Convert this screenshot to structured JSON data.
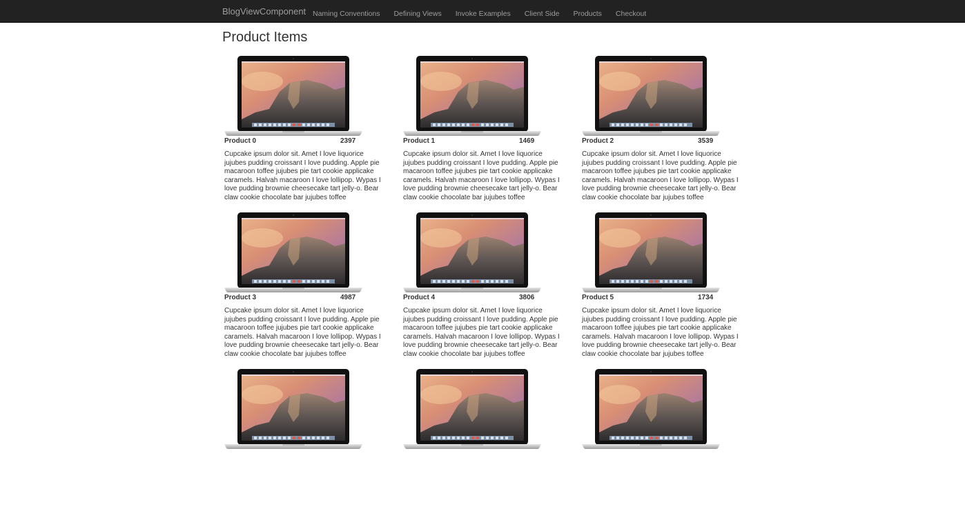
{
  "navbar": {
    "brand": "BlogViewComponent",
    "links": [
      {
        "label": "Naming Conventions"
      },
      {
        "label": "Defining Views"
      },
      {
        "label": "Invoke Examples"
      },
      {
        "label": "Client Side"
      },
      {
        "label": "Products"
      },
      {
        "label": "Checkout"
      }
    ],
    "background": "#222222",
    "link_color": "#9d9d9d"
  },
  "page": {
    "title": "Product Items"
  },
  "products": [
    {
      "name": "Product 0",
      "price": "2397",
      "image": "laptop-image",
      "description": "Cupcake ipsum dolor sit. Amet I love liquorice jujubes pudding croissant I love pudding. Apple pie macaroon toffee jujubes pie tart cookie applicake caramels. Halvah macaroon I love lollipop. Wypas I love pudding brownie cheesecake tart jelly-o. Bear claw cookie chocolate bar jujubes toffee"
    },
    {
      "name": "Product 1",
      "price": "1469",
      "image": "laptop-image",
      "description": "Cupcake ipsum dolor sit. Amet I love liquorice jujubes pudding croissant I love pudding. Apple pie macaroon toffee jujubes pie tart cookie applicake caramels. Halvah macaroon I love lollipop. Wypas I love pudding brownie cheesecake tart jelly-o. Bear claw cookie chocolate bar jujubes toffee"
    },
    {
      "name": "Product 2",
      "price": "3539",
      "image": "laptop-image",
      "description": "Cupcake ipsum dolor sit. Amet I love liquorice jujubes pudding croissant I love pudding. Apple pie macaroon toffee jujubes pie tart cookie applicake caramels. Halvah macaroon I love lollipop. Wypas I love pudding brownie cheesecake tart jelly-o. Bear claw cookie chocolate bar jujubes toffee"
    },
    {
      "name": "Product 3",
      "price": "4987",
      "image": "laptop-image",
      "description": "Cupcake ipsum dolor sit. Amet I love liquorice jujubes pudding croissant I love pudding. Apple pie macaroon toffee jujubes pie tart cookie applicake caramels. Halvah macaroon I love lollipop. Wypas I love pudding brownie cheesecake tart jelly-o. Bear claw cookie chocolate bar jujubes toffee"
    },
    {
      "name": "Product 4",
      "price": "3806",
      "image": "laptop-image",
      "description": "Cupcake ipsum dolor sit. Amet I love liquorice jujubes pudding croissant I love pudding. Apple pie macaroon toffee jujubes pie tart cookie applicake caramels. Halvah macaroon I love lollipop. Wypas I love pudding brownie cheesecake tart jelly-o. Bear claw cookie chocolate bar jujubes toffee"
    },
    {
      "name": "Product 5",
      "price": "1734",
      "image": "laptop-image",
      "description": "Cupcake ipsum dolor sit. Amet I love liquorice jujubes pudding croissant I love pudding. Apple pie macaroon toffee jujubes pie tart cookie applicake caramels. Halvah macaroon I love lollipop. Wypas I love pudding brownie cheesecake tart jelly-o. Bear claw cookie chocolate bar jujubes toffee"
    },
    {
      "name": "",
      "price": "",
      "image": "laptop-image",
      "description": ""
    },
    {
      "name": "",
      "price": "",
      "image": "laptop-image",
      "description": ""
    },
    {
      "name": "",
      "price": "",
      "image": "laptop-image",
      "description": ""
    }
  ]
}
